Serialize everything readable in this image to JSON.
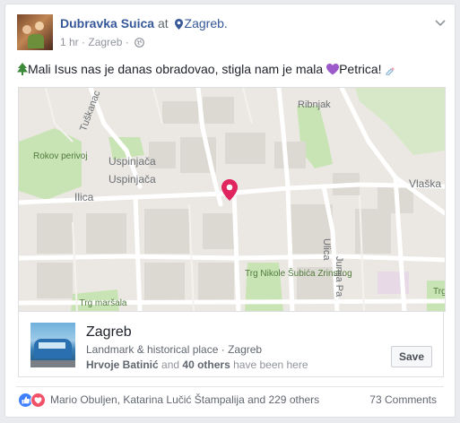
{
  "post": {
    "author": "Dubravka Suica",
    "at_text": "at",
    "location": "Zagreb.",
    "time": "1 hr",
    "separator": "·",
    "meta_location": "Zagreb",
    "text": "Mali Isus nas je danas obradovao, stigla nam je mala",
    "text_name": "Petrica!",
    "icons": {
      "privacy": "globe-icon",
      "emoji_start": "christmas-tree-icon",
      "emoji_heart": "purple-heart-icon",
      "emoji_end": "baby-bottle-icon"
    }
  },
  "map": {
    "labels": {
      "tuskanac": "Tuškanac",
      "ribnjak": "Ribnjak",
      "rokov_perivoj": "Rokov perivoj",
      "uspinjaca_1": "Uspinjača",
      "uspinjaca_2": "Uspinjača",
      "ilica": "Ilica",
      "vlaska": "Vlaška u",
      "trg_nikole": "Trg Nikole Šubića Zrinskog",
      "trg_marsala": "Trg maršala",
      "ulica": "Ulica",
      "junija": "Junija Pa",
      "trg_right": "Trg"
    },
    "colors": {
      "park": "#c9e4b4",
      "pin": "#e0245e",
      "road": "#ffffff",
      "block": "#dcd8d2"
    }
  },
  "place": {
    "name": "Zagreb",
    "type": "Landmark & historical place · Zagreb",
    "visitor_name": "Hrvoje Batinić",
    "visitor_and": "and",
    "visitor_others": "40 others",
    "visitor_suffix": "have been here",
    "save_label": "Save"
  },
  "footer": {
    "reactors": "Mario Obuljen, Katarina Lučić Štampalija and 229 others",
    "comments": "73 Comments"
  },
  "colors": {
    "link": "#365899",
    "like": "#4080ff",
    "love": "#f25268"
  }
}
